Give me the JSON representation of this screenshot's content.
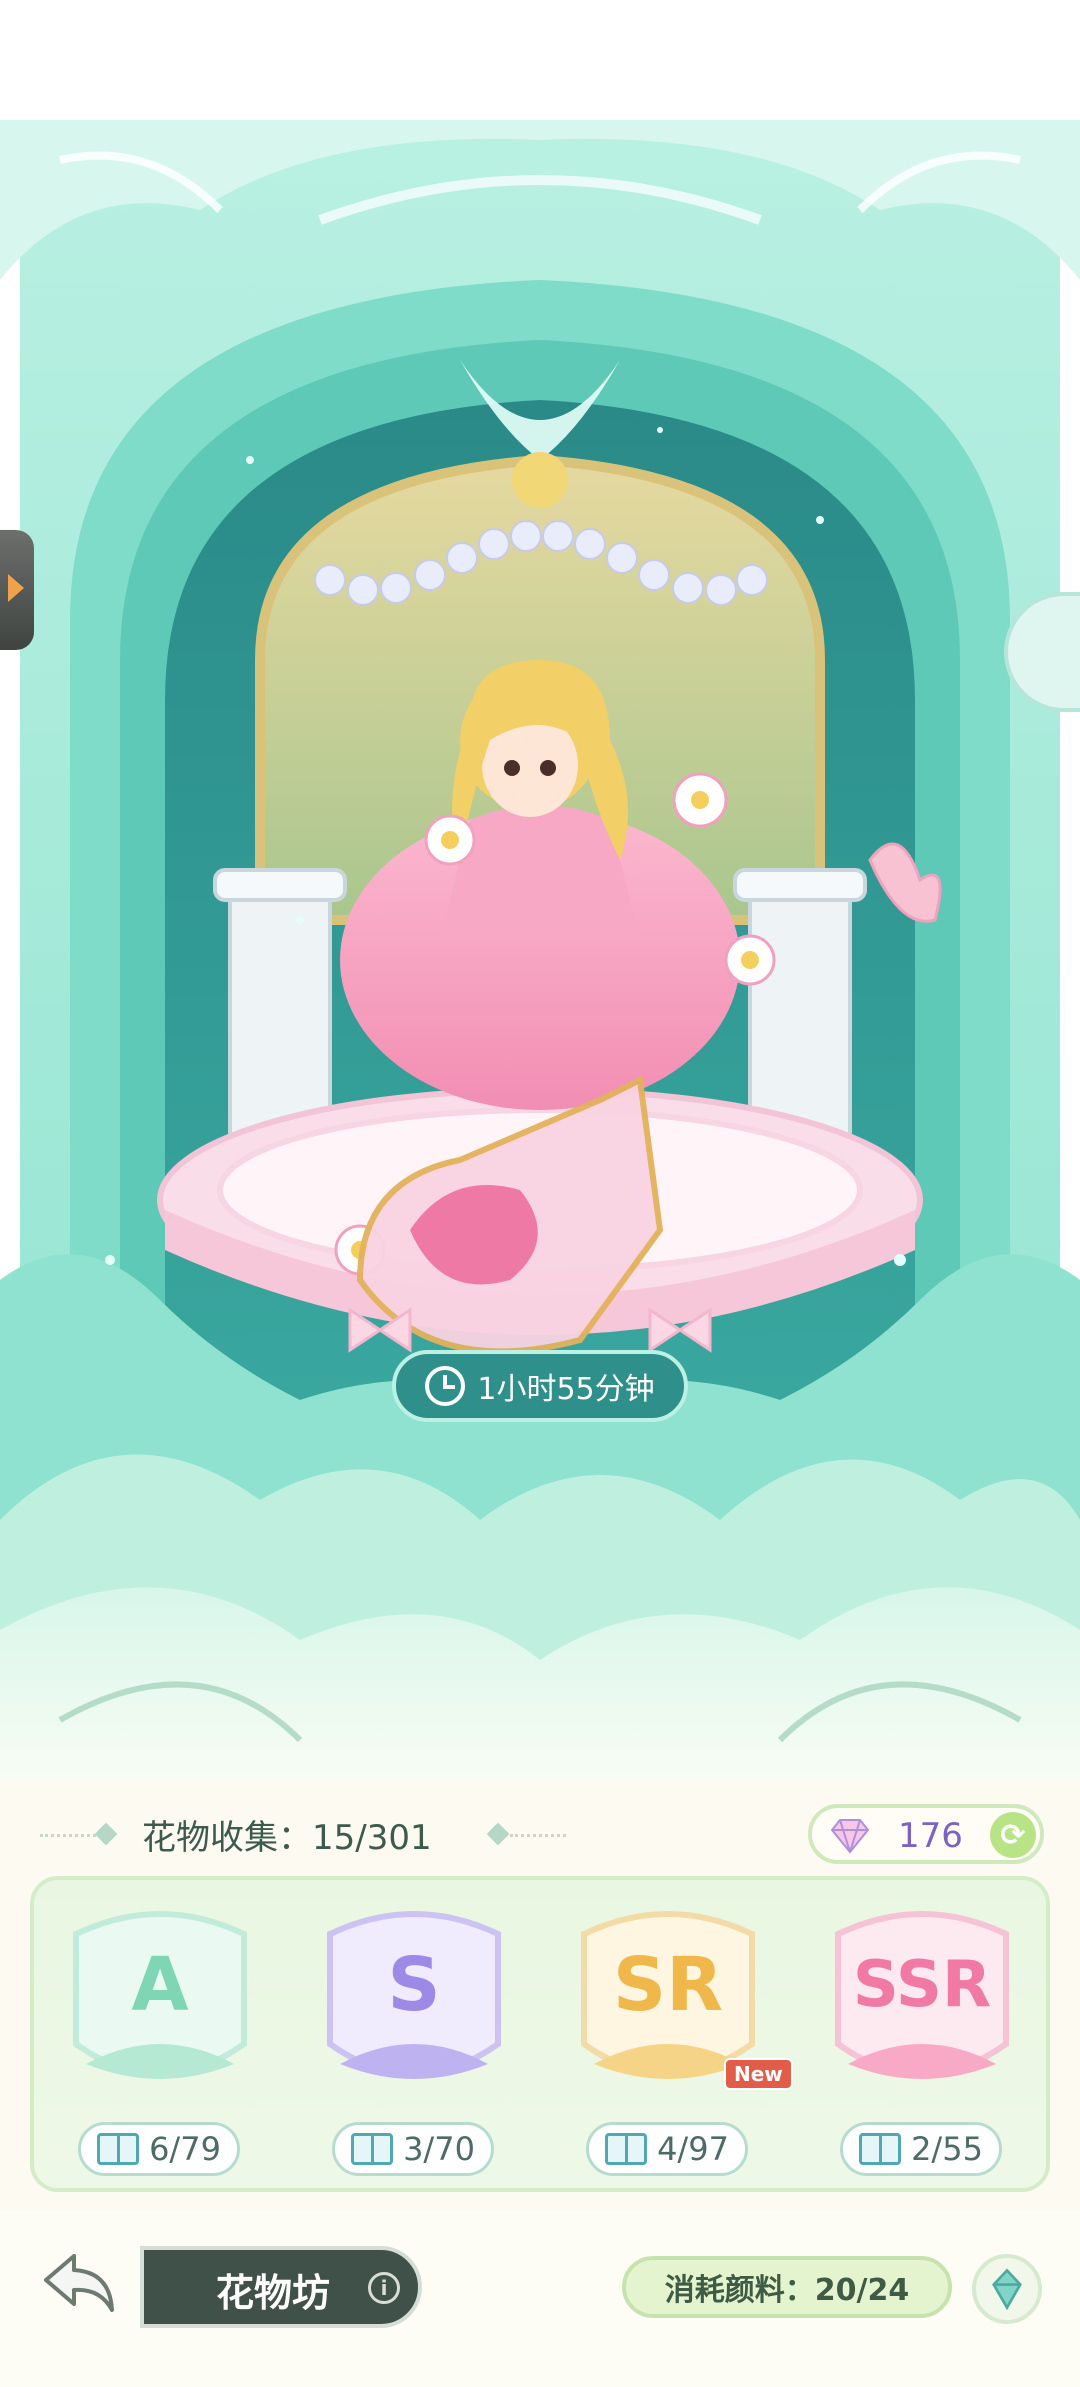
{
  "scene": {
    "timer_text": "1小时55分钟"
  },
  "collection": {
    "label": "花物收集：15/301",
    "gems": "176"
  },
  "rarity_cards": [
    {
      "letter": "A",
      "count": "6/79",
      "color": "#7fd6b4",
      "new": false
    },
    {
      "letter": "S",
      "count": "3/70",
      "color": "#9c8ae6",
      "new": false
    },
    {
      "letter": "SR",
      "count": "4/97",
      "color": "#f0b84a",
      "new": true,
      "new_label": "New"
    },
    {
      "letter": "SSR",
      "count": "2/55",
      "color": "#f07aa4",
      "new": false
    }
  ],
  "bottom": {
    "workshop_label": "花物坊",
    "info_glyph": "i",
    "cost_text": "消耗颜料：20/24"
  },
  "colors": {
    "teal": "#2f8f8a",
    "mint": "#a6ecd9",
    "panel": "#fcfaf1"
  }
}
